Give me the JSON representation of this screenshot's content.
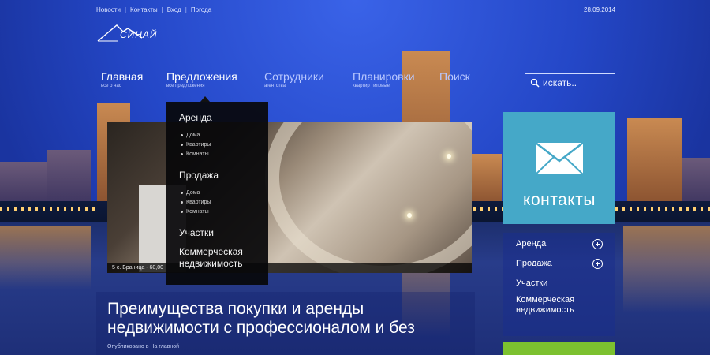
{
  "top_links": [
    "Новости",
    "Контакты",
    "Вход",
    "Погода"
  ],
  "date": "28.09.2014",
  "logo_text": "СИНАЙ",
  "nav": [
    {
      "label": "Главная",
      "sub": "все о нас"
    },
    {
      "label": "Предложения",
      "sub": "все предложения"
    },
    {
      "label": "Сотрудники",
      "sub": "агентства"
    },
    {
      "label": "Планировки",
      "sub": "квартир типовые"
    },
    {
      "label": "Поиск",
      "sub": ""
    }
  ],
  "search": {
    "placeholder": "искать.."
  },
  "dropdown": {
    "rent": {
      "title": "Аренда",
      "items": [
        "Дома",
        "Квартиры",
        "Комнаты"
      ]
    },
    "sale": {
      "title": "Продажа",
      "items": [
        "Дома",
        "Квартиры",
        "Комнаты"
      ]
    },
    "plots": "Участки",
    "commercial": "Коммерческая недвижимость"
  },
  "slider": {
    "caption": "5 с. Браница - 60,00"
  },
  "contact_tile": {
    "label": "контакты",
    "icon": "envelope-icon",
    "color": "#45a8c8"
  },
  "side_menu": [
    "Аренда",
    "Продажа",
    "Участки",
    "Коммерческая недвижимость"
  ],
  "article": {
    "title": "Преимущества покупки и аренды недвижимости с профессионалом и без",
    "meta": "Опубликовано в На главной"
  },
  "colors": {
    "accent_green": "#7cc12f",
    "sky": "#2447c7"
  }
}
